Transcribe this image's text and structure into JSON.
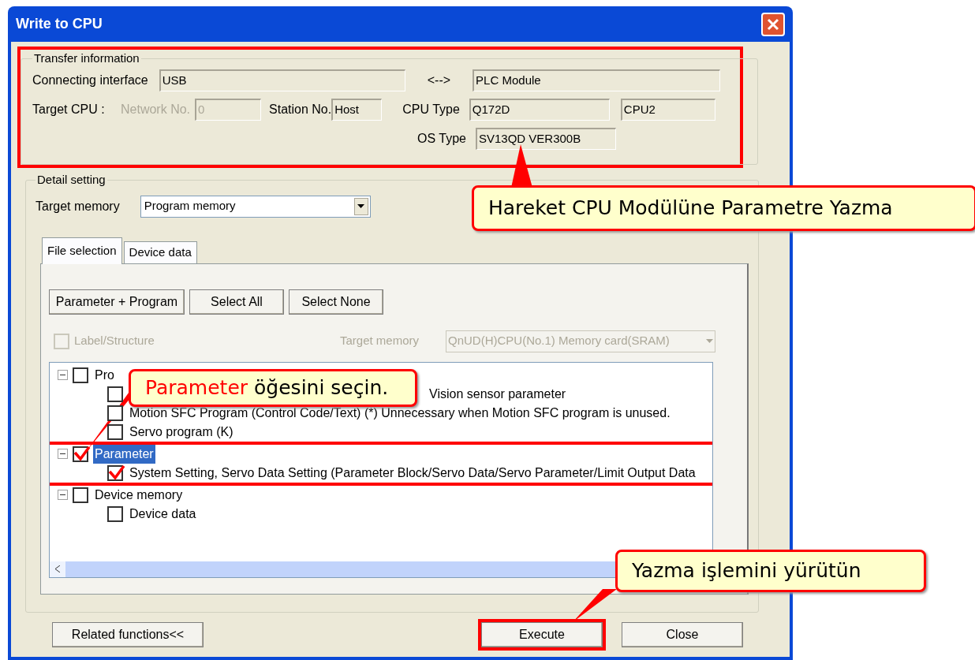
{
  "window": {
    "title": "Write to CPU"
  },
  "transfer_information": {
    "legend": "Transfer information",
    "highlighted": true,
    "connecting_interface_label": "Connecting interface",
    "connecting_interface": "USB",
    "arrow": "<-->",
    "plc_module": "PLC Module",
    "target_cpu_label": "Target CPU :",
    "network_no_label": "Network No.",
    "network_no": "0",
    "station_no_label": "Station No.",
    "station_no": "Host",
    "cpu_type_label": "CPU Type",
    "cpu_type": "Q172D",
    "cpu_no": "CPU2",
    "os_type_label": "OS Type",
    "os_type": "SV13QD VER300B"
  },
  "detail_setting": {
    "legend": "Detail setting",
    "target_memory_label": "Target memory",
    "target_memory": "Program memory",
    "tabs": [
      {
        "label": "File selection",
        "selected": true
      },
      {
        "label": "Device data",
        "selected": false
      }
    ],
    "buttons": [
      "Parameter + Program",
      "Select All",
      "Select None"
    ],
    "label_structure": {
      "label": "Label/Structure",
      "checked": false,
      "disabled": true
    },
    "file_target_memory_label": "Target memory",
    "file_target_memory": "QnUD(H)CPU(No.1) Memory card(SRAM)",
    "tree": [
      {
        "label": "Pro",
        "kind": "normal",
        "checked": false,
        "selected": false,
        "highlighted": false,
        "children": [
          {
            "label": "Vision sensor parameter",
            "kind": "obscured",
            "checked": false,
            "selected": false
          },
          {
            "label": "Motion SFC Program (Control Code/Text)  (*) Unnecessary when Motion SFC program is unused.",
            "kind": "normal",
            "checked": false,
            "selected": false
          },
          {
            "label": "Servo program (K)",
            "kind": "normal",
            "checked": false,
            "selected": false
          }
        ]
      },
      {
        "label": "Parameter",
        "kind": "normal",
        "checked": true,
        "selected": true,
        "highlighted": true,
        "children": [
          {
            "label": "System Setting, Servo Data Setting (Parameter Block/Servo Data/Servo Parameter/Limit Output Data",
            "kind": "normal",
            "checked": true,
            "selected": false
          }
        ]
      },
      {
        "label": "Device memory",
        "kind": "normal",
        "checked": false,
        "selected": false,
        "highlighted": false,
        "children": [
          {
            "label": "Device data",
            "kind": "normal",
            "checked": false,
            "selected": false
          }
        ]
      }
    ]
  },
  "footer_buttons": [
    {
      "label": "Related functions<<",
      "highlighted": false
    },
    {
      "label": "Execute",
      "highlighted": true
    },
    {
      "label": "Close",
      "highlighted": false
    }
  ],
  "callouts": [
    {
      "text": "Hareket CPU Modülüne Parametre Yazma"
    },
    {
      "highlight": "Parameter",
      "text": "öğesini seçin."
    },
    {
      "text": "Yazma işlemini yürütün"
    }
  ]
}
